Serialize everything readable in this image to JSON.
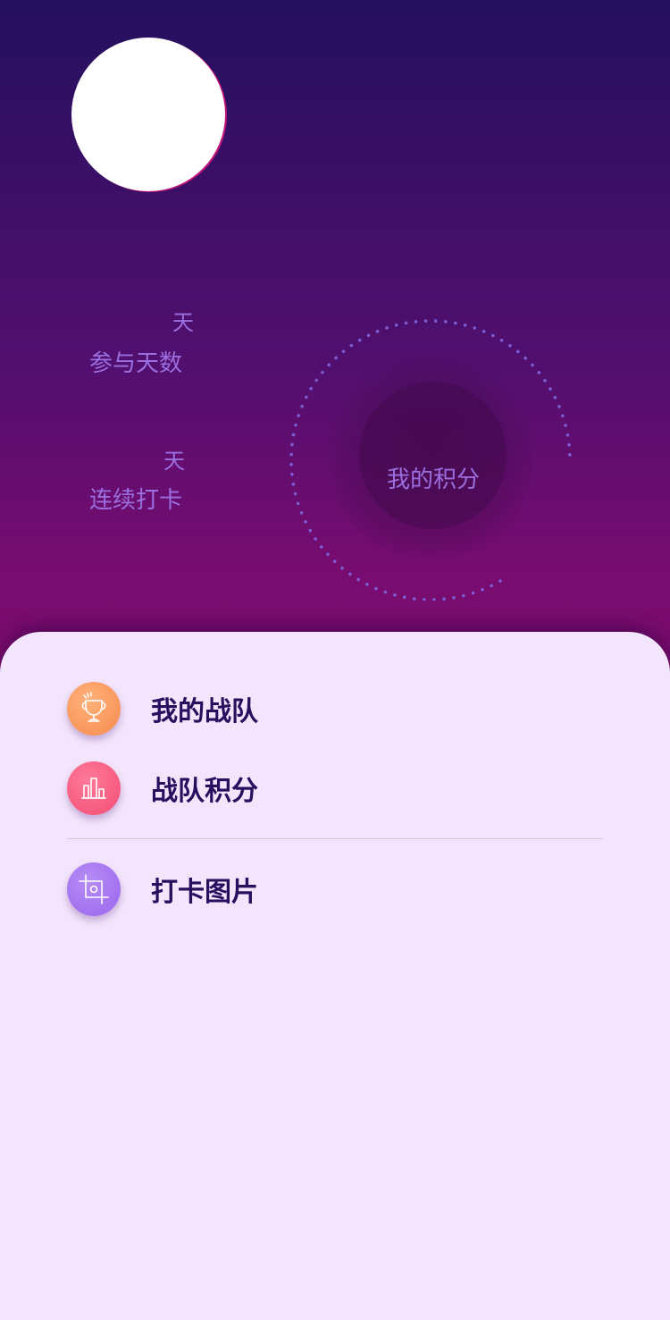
{
  "profile": {
    "avatar_alt": ""
  },
  "stats": {
    "participation": {
      "unit": "天",
      "label": "参与天数"
    },
    "streak": {
      "unit": "天",
      "label": "连续打卡"
    }
  },
  "score": {
    "label": "我的积分"
  },
  "menu": {
    "items": [
      {
        "label": "我的战队",
        "icon": "trophy-icon",
        "color": "#f68a4f"
      },
      {
        "label": "战队积分",
        "icon": "bar-chart-icon",
        "color": "#f24d73"
      },
      {
        "label": "打卡图片",
        "icon": "crop-icon",
        "color": "#9a66ee"
      }
    ]
  },
  "colors": {
    "hero_top": "#24105e",
    "hero_bottom": "#7a0a6b",
    "stat_text": "#9b6fe0",
    "sheet_bg": "#f3e5fb",
    "menu_text": "#2a0f5e"
  }
}
